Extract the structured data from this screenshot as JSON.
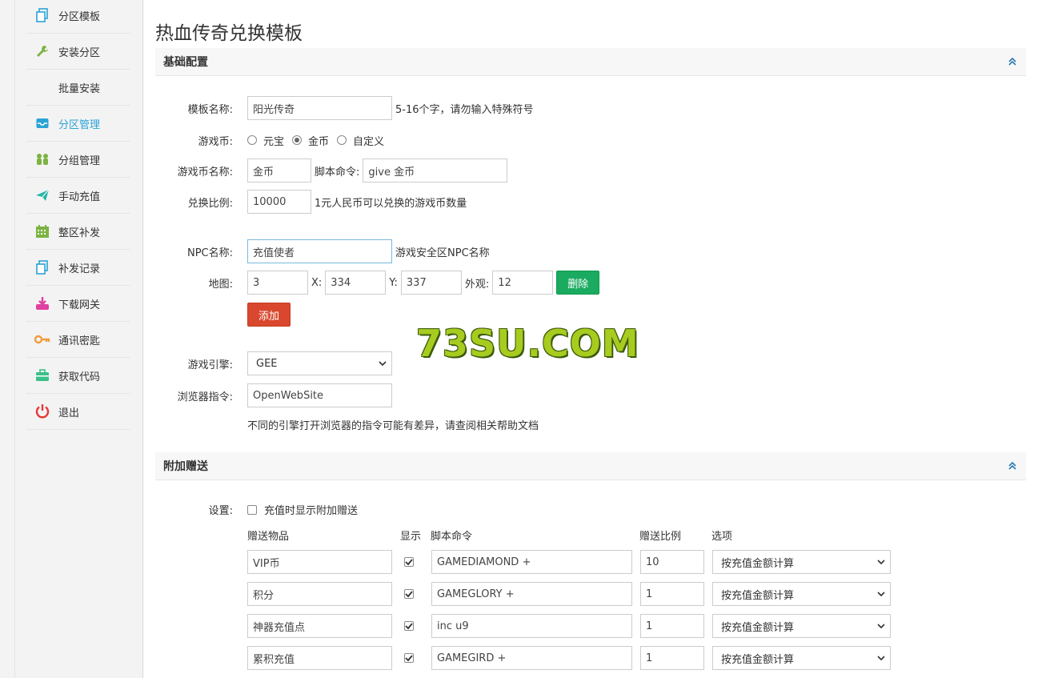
{
  "sidebar": {
    "items": [
      {
        "label": "分区模板",
        "icon": "copy-icon",
        "color": "#2aa3d6"
      },
      {
        "label": "安装分区",
        "icon": "wrench-icon",
        "color": "#7cb342"
      },
      {
        "label": "批量安装",
        "icon": "",
        "color": ""
      },
      {
        "label": "分区管理",
        "icon": "inbox-icon",
        "color": "#2aa3d6",
        "active": true
      },
      {
        "label": "分组管理",
        "icon": "users-icon",
        "color": "#7cb342"
      },
      {
        "label": "手动充值",
        "icon": "paper-plane-icon",
        "color": "#26b5a8"
      },
      {
        "label": "整区补发",
        "icon": "calendar-icon",
        "color": "#7cb342"
      },
      {
        "label": "补发记录",
        "icon": "copy-icon",
        "color": "#2aa3d6"
      },
      {
        "label": "下载网关",
        "icon": "download-icon",
        "color": "#e040a0"
      },
      {
        "label": "通讯密匙",
        "icon": "key-icon",
        "color": "#f39c3c"
      },
      {
        "label": "获取代码",
        "icon": "briefcase-icon",
        "color": "#3cc08a"
      },
      {
        "label": "退出",
        "icon": "power-icon",
        "color": "#e53935"
      }
    ]
  },
  "page": {
    "title": "热血传奇兑换模板"
  },
  "basic": {
    "section_title": "基础配置",
    "template_name_label": "模板名称:",
    "template_name_value": "阳光传奇",
    "template_name_help": "5-16个字，请勿输入特殊符号",
    "currency_label": "游戏币:",
    "currency_options": [
      "元宝",
      "金币",
      "自定义"
    ],
    "currency_selected": "金币",
    "currency_name_label": "游戏币名称:",
    "currency_name_value": "金币",
    "script_cmd_label": "脚本命令:",
    "script_cmd_value": "give 金币",
    "ratio_label": "兑换比例:",
    "ratio_value": "10000",
    "ratio_help": "1元人民币可以兑换的游戏币数量",
    "npc_label": "NPC名称:",
    "npc_value": "充值使者",
    "npc_help": "游戏安全区NPC名称",
    "map_label": "地图:",
    "map_value": "3",
    "x_label": "X:",
    "x_value": "334",
    "y_label": "Y:",
    "y_value": "337",
    "look_label": "外观:",
    "look_value": "12",
    "delete_label": "删除",
    "add_label": "添加",
    "engine_label": "游戏引擎:",
    "engine_value": "GEE",
    "browser_label": "浏览器指令:",
    "browser_value": "OpenWebSite",
    "browser_help": "不同的引擎打开浏览器的指令可能有差异，请查阅相关帮助文档"
  },
  "watermark": "73SU.COM",
  "gift": {
    "section_title": "附加赠送",
    "settings_label": "设置:",
    "show_checkbox_label": "充值时显示附加赠送",
    "columns": {
      "item": "赠送物品",
      "show": "显示",
      "script": "脚本命令",
      "ratio": "赠送比例",
      "option": "选项"
    },
    "rows": [
      {
        "item": "VIP币",
        "show": true,
        "script": "GAMEDIAMOND +",
        "ratio": "10",
        "option": "按充值金额计算"
      },
      {
        "item": "积分",
        "show": true,
        "script": "GAMEGLORY +",
        "ratio": "1",
        "option": "按充值金额计算"
      },
      {
        "item": "神器充值点",
        "show": true,
        "script": "inc u9",
        "ratio": "1",
        "option": "按充值金额计算"
      },
      {
        "item": "累积充值",
        "show": true,
        "script": "GAMEGIRD +",
        "ratio": "1",
        "option": "按充值金额计算"
      }
    ]
  }
}
